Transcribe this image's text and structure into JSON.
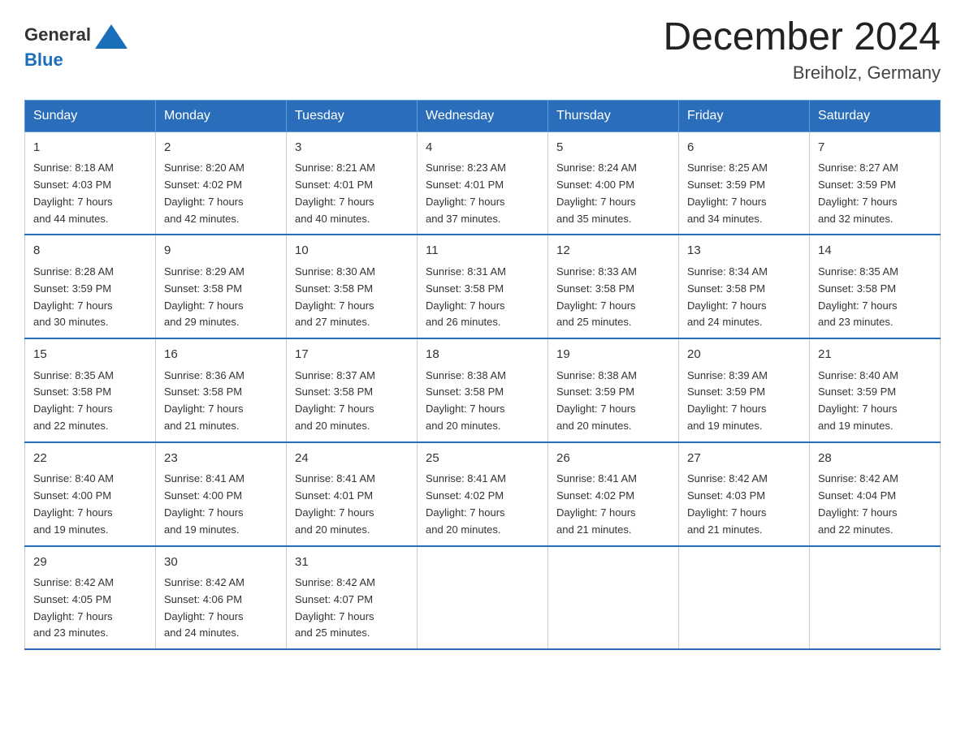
{
  "header": {
    "logo_general": "General",
    "logo_blue": "Blue",
    "title": "December 2024",
    "subtitle": "Breiholz, Germany"
  },
  "weekdays": [
    "Sunday",
    "Monday",
    "Tuesday",
    "Wednesday",
    "Thursday",
    "Friday",
    "Saturday"
  ],
  "weeks": [
    [
      {
        "day": "1",
        "sunrise": "8:18 AM",
        "sunset": "4:03 PM",
        "daylight": "7 hours and 44 minutes."
      },
      {
        "day": "2",
        "sunrise": "8:20 AM",
        "sunset": "4:02 PM",
        "daylight": "7 hours and 42 minutes."
      },
      {
        "day": "3",
        "sunrise": "8:21 AM",
        "sunset": "4:01 PM",
        "daylight": "7 hours and 40 minutes."
      },
      {
        "day": "4",
        "sunrise": "8:23 AM",
        "sunset": "4:01 PM",
        "daylight": "7 hours and 37 minutes."
      },
      {
        "day": "5",
        "sunrise": "8:24 AM",
        "sunset": "4:00 PM",
        "daylight": "7 hours and 35 minutes."
      },
      {
        "day": "6",
        "sunrise": "8:25 AM",
        "sunset": "3:59 PM",
        "daylight": "7 hours and 34 minutes."
      },
      {
        "day": "7",
        "sunrise": "8:27 AM",
        "sunset": "3:59 PM",
        "daylight": "7 hours and 32 minutes."
      }
    ],
    [
      {
        "day": "8",
        "sunrise": "8:28 AM",
        "sunset": "3:59 PM",
        "daylight": "7 hours and 30 minutes."
      },
      {
        "day": "9",
        "sunrise": "8:29 AM",
        "sunset": "3:58 PM",
        "daylight": "7 hours and 29 minutes."
      },
      {
        "day": "10",
        "sunrise": "8:30 AM",
        "sunset": "3:58 PM",
        "daylight": "7 hours and 27 minutes."
      },
      {
        "day": "11",
        "sunrise": "8:31 AM",
        "sunset": "3:58 PM",
        "daylight": "7 hours and 26 minutes."
      },
      {
        "day": "12",
        "sunrise": "8:33 AM",
        "sunset": "3:58 PM",
        "daylight": "7 hours and 25 minutes."
      },
      {
        "day": "13",
        "sunrise": "8:34 AM",
        "sunset": "3:58 PM",
        "daylight": "7 hours and 24 minutes."
      },
      {
        "day": "14",
        "sunrise": "8:35 AM",
        "sunset": "3:58 PM",
        "daylight": "7 hours and 23 minutes."
      }
    ],
    [
      {
        "day": "15",
        "sunrise": "8:35 AM",
        "sunset": "3:58 PM",
        "daylight": "7 hours and 22 minutes."
      },
      {
        "day": "16",
        "sunrise": "8:36 AM",
        "sunset": "3:58 PM",
        "daylight": "7 hours and 21 minutes."
      },
      {
        "day": "17",
        "sunrise": "8:37 AM",
        "sunset": "3:58 PM",
        "daylight": "7 hours and 20 minutes."
      },
      {
        "day": "18",
        "sunrise": "8:38 AM",
        "sunset": "3:58 PM",
        "daylight": "7 hours and 20 minutes."
      },
      {
        "day": "19",
        "sunrise": "8:38 AM",
        "sunset": "3:59 PM",
        "daylight": "7 hours and 20 minutes."
      },
      {
        "day": "20",
        "sunrise": "8:39 AM",
        "sunset": "3:59 PM",
        "daylight": "7 hours and 19 minutes."
      },
      {
        "day": "21",
        "sunrise": "8:40 AM",
        "sunset": "3:59 PM",
        "daylight": "7 hours and 19 minutes."
      }
    ],
    [
      {
        "day": "22",
        "sunrise": "8:40 AM",
        "sunset": "4:00 PM",
        "daylight": "7 hours and 19 minutes."
      },
      {
        "day": "23",
        "sunrise": "8:41 AM",
        "sunset": "4:00 PM",
        "daylight": "7 hours and 19 minutes."
      },
      {
        "day": "24",
        "sunrise": "8:41 AM",
        "sunset": "4:01 PM",
        "daylight": "7 hours and 20 minutes."
      },
      {
        "day": "25",
        "sunrise": "8:41 AM",
        "sunset": "4:02 PM",
        "daylight": "7 hours and 20 minutes."
      },
      {
        "day": "26",
        "sunrise": "8:41 AM",
        "sunset": "4:02 PM",
        "daylight": "7 hours and 21 minutes."
      },
      {
        "day": "27",
        "sunrise": "8:42 AM",
        "sunset": "4:03 PM",
        "daylight": "7 hours and 21 minutes."
      },
      {
        "day": "28",
        "sunrise": "8:42 AM",
        "sunset": "4:04 PM",
        "daylight": "7 hours and 22 minutes."
      }
    ],
    [
      {
        "day": "29",
        "sunrise": "8:42 AM",
        "sunset": "4:05 PM",
        "daylight": "7 hours and 23 minutes."
      },
      {
        "day": "30",
        "sunrise": "8:42 AM",
        "sunset": "4:06 PM",
        "daylight": "7 hours and 24 minutes."
      },
      {
        "day": "31",
        "sunrise": "8:42 AM",
        "sunset": "4:07 PM",
        "daylight": "7 hours and 25 minutes."
      },
      null,
      null,
      null,
      null
    ]
  ],
  "labels": {
    "sunrise": "Sunrise:",
    "sunset": "Sunset:",
    "daylight": "Daylight:"
  }
}
